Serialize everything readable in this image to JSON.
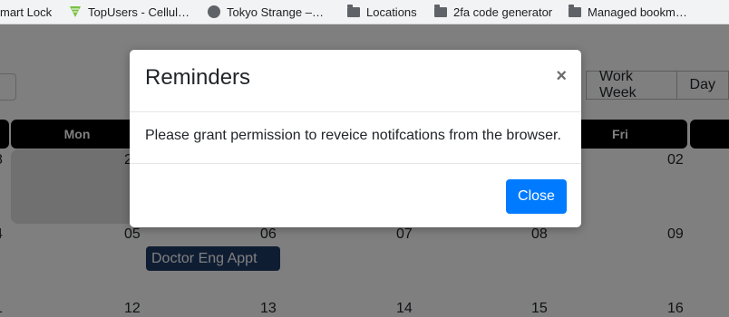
{
  "bookmarks": [
    {
      "label": "mart Lock"
    },
    {
      "label": "TopUsers - Cellul…",
      "icon": "signal-icon"
    },
    {
      "label": "Tokyo Strange –…",
      "icon": "globe-icon"
    },
    {
      "label": "Locations",
      "icon": "folder-icon"
    },
    {
      "label": "2fa code generator",
      "icon": "folder-icon"
    },
    {
      "label": "Managed bookm…",
      "icon": "folder-icon"
    }
  ],
  "calendar": {
    "views": [
      "Work Week",
      "Day"
    ],
    "day_headers": [
      {
        "label": ""
      },
      {
        "label": "Mon"
      },
      {
        "label": "Fri"
      },
      {
        "label": ""
      }
    ],
    "day_numbers": [
      "8",
      "2",
      "02",
      "4",
      "05",
      "06",
      "07",
      "08",
      "09",
      "1",
      "12",
      "13",
      "14",
      "15",
      "16"
    ],
    "event": "Doctor Eng Appt"
  },
  "modal": {
    "title": "Reminders",
    "close_symbol": "×",
    "body": "Please grant permission to reveice notifcations from the browser.",
    "close_button": "Close"
  },
  "colors": {
    "primary": "#007bff",
    "event": "#1e3a66",
    "header": "#000000"
  }
}
